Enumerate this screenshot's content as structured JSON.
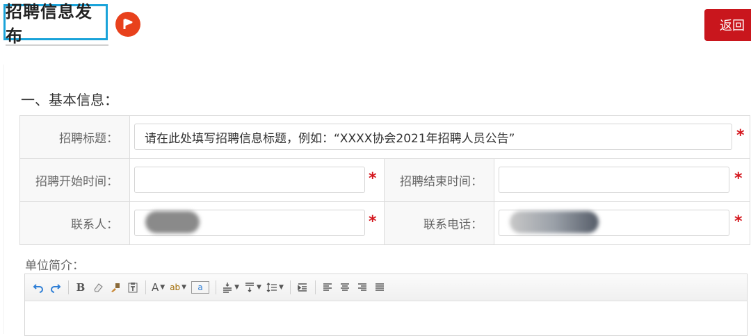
{
  "header": {
    "title": "招聘信息发布",
    "back_label": "返回",
    "accent_color": "#1aa3d9",
    "icon": "play-icon"
  },
  "section1": {
    "title": "一、基本信息："
  },
  "form": {
    "title_label": "招聘标题：",
    "title_value": "请在此处填写招聘信息标题，例如：“XXXX协会2021年招聘人员公告”",
    "start_label": "招聘开始时间：",
    "end_label": "招聘结束时间：",
    "contact_label": "联系人：",
    "phone_label": "联系电话：",
    "required_mark": "*"
  },
  "description": {
    "label": "单位简介："
  },
  "editor": {
    "toolbar": [
      "undo-icon",
      "redo-icon",
      "bold-icon",
      "eraser-icon",
      "format-brush-icon",
      "paste-text-icon",
      "font-color-icon",
      "highlight-icon",
      "border-icon",
      "line-height-icon",
      "paragraph-spacing-icon",
      "list-spacing-icon",
      "indent-icon",
      "align-left-icon",
      "align-center-icon",
      "align-right-icon",
      "justify-icon"
    ],
    "bold_glyph": "B",
    "font_glyph": "A",
    "highlight_glyph": "ab",
    "border_glyph": "a"
  }
}
